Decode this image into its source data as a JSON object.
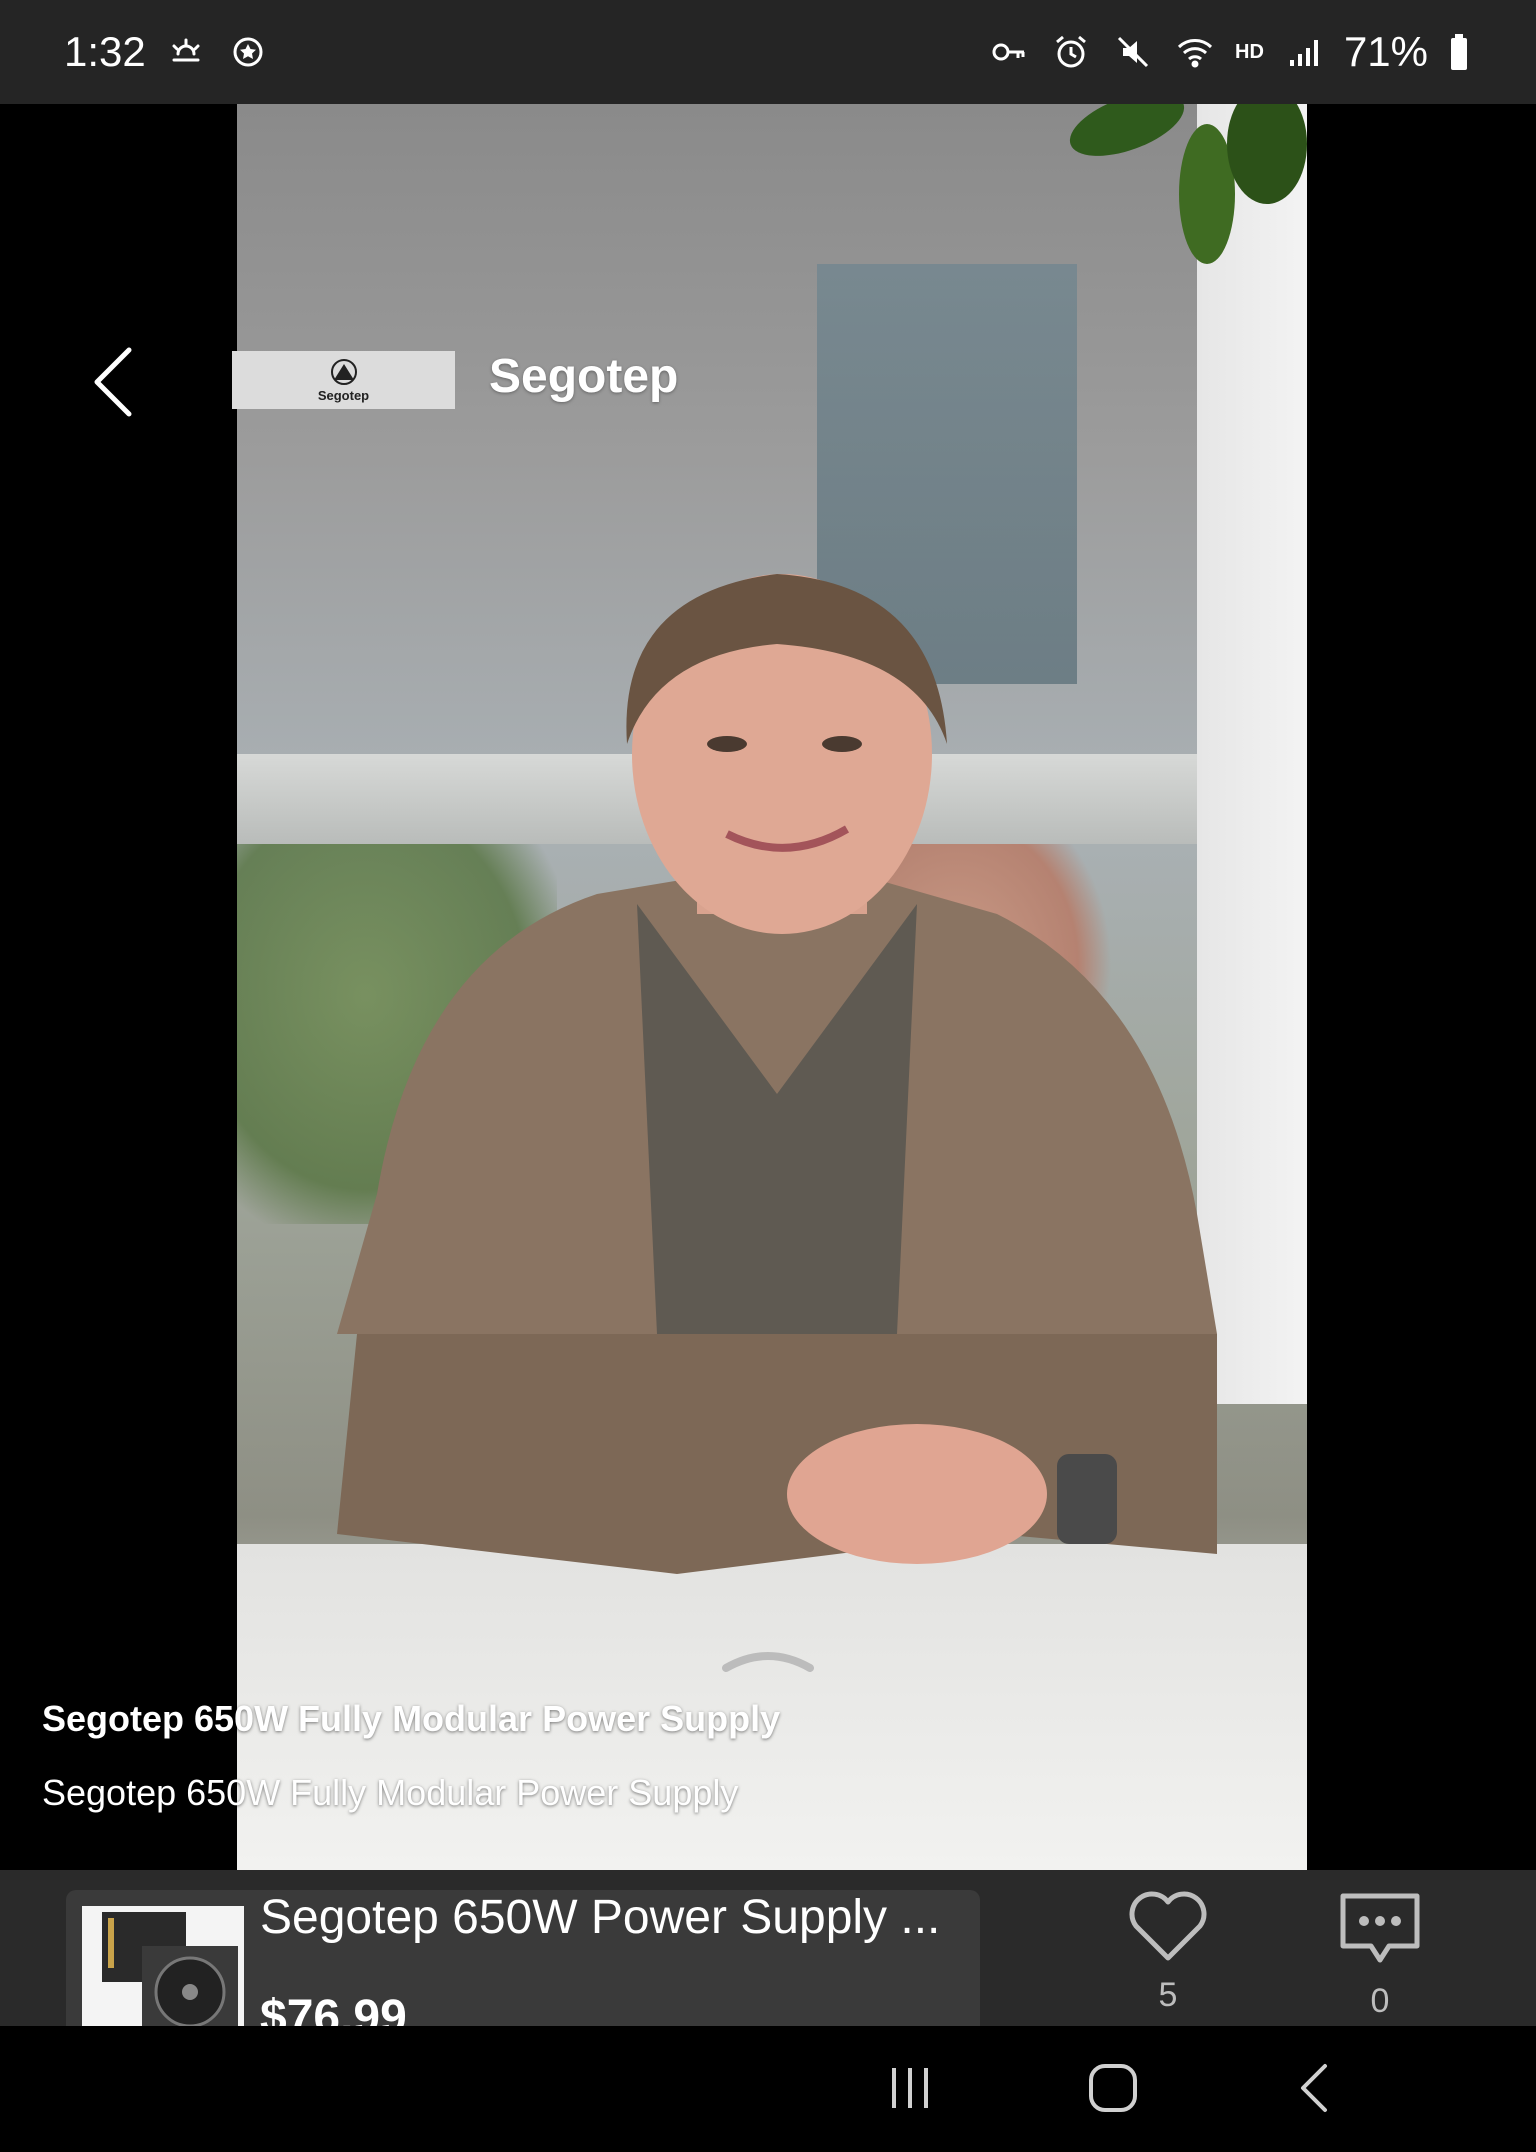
{
  "status_bar": {
    "time": "1:32",
    "battery": "71%",
    "hd": "HD",
    "icons_left": [
      "weather-icon",
      "settings-badge-icon"
    ],
    "icons_right": [
      "vpn-key-icon",
      "alarm-icon",
      "mute-icon",
      "wifi-icon",
      "signal-icon",
      "battery-icon"
    ]
  },
  "header": {
    "back_icon": "chevron-left-icon",
    "brand_name": "Segotep",
    "logo_text": "Segotep"
  },
  "video": {
    "caption_title": "Segotep 650W Fully Modular Power Supply",
    "caption_subtitle": "Segotep 650W Fully Modular Power Supply"
  },
  "product": {
    "title": "Segotep 650W Power Supply ...",
    "price": "$76.99",
    "like_count": "5",
    "comment_count": "0"
  },
  "nav": {
    "buttons": [
      "recent-apps-icon",
      "home-icon",
      "back-icon"
    ]
  },
  "colors": {
    "status_bar_bg": "#252525",
    "product_bar_bg": "#2a2a2a",
    "card_bg": "#3a3a3a"
  }
}
